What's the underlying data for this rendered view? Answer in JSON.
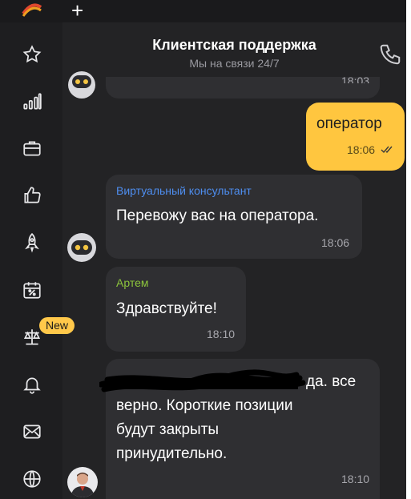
{
  "header": {
    "title": "Клиентская поддержка",
    "subtitle": "Мы на связи 24/7"
  },
  "tabs": {
    "new_tab_label": "+"
  },
  "rail": {
    "new_badge": "New"
  },
  "messages": [
    {
      "time": "18:03"
    },
    {
      "text": "оператор",
      "time": "18:06"
    },
    {
      "sender": "Виртуальный консультант",
      "text": "Перевожу вас на оператора.",
      "time": "18:06"
    },
    {
      "sender": "Артем",
      "text": "Здравствуйте!",
      "time": "18:10"
    },
    {
      "text_after_redaction": "да. все",
      "text_lines": [
        "верно. Короткие позиции",
        "будут закрыты",
        "принудительно."
      ],
      "time": "18:10"
    }
  ],
  "colors": {
    "accent": "#ffc63f",
    "bot_sender": "#4e8ef0",
    "agent_sender": "#8cc43c"
  }
}
